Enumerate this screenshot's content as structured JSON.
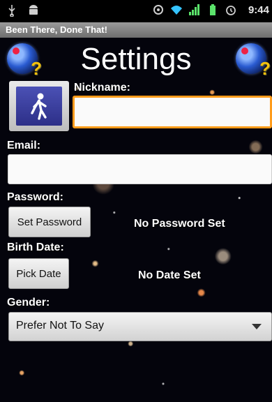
{
  "status_bar": {
    "time": "9:44",
    "icons": [
      "usb-icon",
      "android-icon",
      "sync-icon",
      "wifi-icon",
      "signal-icon",
      "battery-icon",
      "alarm-icon"
    ]
  },
  "app": {
    "title": "Been There, Done That!"
  },
  "header": {
    "title": "Settings"
  },
  "form": {
    "nickname_label": "Nickname:",
    "nickname_value": "",
    "email_label": "Email:",
    "email_value": "",
    "password_label": "Password:",
    "set_password_button": "Set Password",
    "password_status": "No Password Set",
    "birth_date_label": "Birth Date:",
    "pick_date_button": "Pick Date",
    "birth_date_status": "No Date Set",
    "gender_label": "Gender:",
    "gender_selected": "Prefer Not To Say"
  },
  "colors": {
    "focus_outline": "#ff9b1a",
    "avatar_tile": "#3a3f9f",
    "title_bar": "#8a8a8a"
  }
}
